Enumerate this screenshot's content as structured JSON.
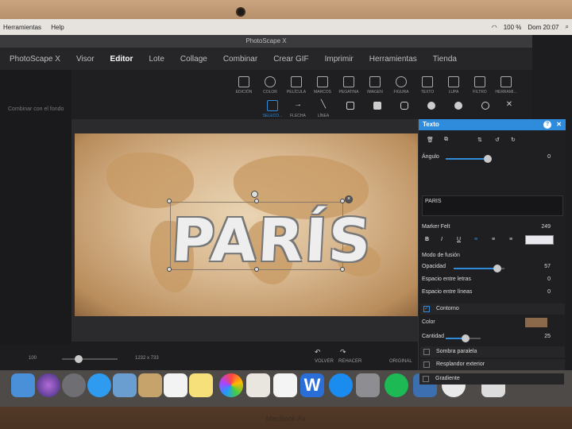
{
  "menubar": {
    "items": [
      "Herramientas",
      "Help"
    ],
    "battery": "100 %",
    "clock": "Dom 20:07"
  },
  "window": {
    "title": "PhotoScape X"
  },
  "tabs": [
    "PhotoScape X",
    "Visor",
    "Editor",
    "Lote",
    "Collage",
    "Combinar",
    "Crear GIF",
    "Imprimir",
    "Herramientas",
    "Tienda"
  ],
  "active_tab": "Editor",
  "toolbar_top": [
    "EDICIÓN",
    "COLOR",
    "PELÍCULA",
    "MARCOS",
    "PEGATINA",
    "IMAGEN",
    "FIGURA",
    "TEXTO",
    "LUPA",
    "FILTRO",
    "HERRAMI..."
  ],
  "toolbar_bottom": [
    "SELECO...",
    "FLECHA",
    "LÍNEA"
  ],
  "leftpanel": {
    "hint": "Combinar con el fondo"
  },
  "canvas": {
    "text": "PARÍS"
  },
  "status": {
    "zoom": "100",
    "dimensions": "1232 x 733",
    "back": "VOLVER",
    "redo": "REHACER",
    "original": "ORIGINAL"
  },
  "panel": {
    "title": "Texto",
    "angle_label": "Ángulo",
    "angle_value": "0",
    "text_value": "PARIS",
    "font_name": "Marker Felt",
    "font_size": "249",
    "blend_label": "Modo de fusión",
    "opacity_label": "Opacidad",
    "opacity_value": "57",
    "letter_spacing_label": "Espacio entre letras",
    "letter_spacing_value": "0",
    "line_spacing_label": "Espacio entre líneas",
    "line_spacing_value": "0",
    "outline_label": "Contorno",
    "color_label": "Color",
    "amount_label": "Cantidad",
    "amount_value": "25",
    "shadow_label": "Sombra paralela",
    "glow_label": "Resplandor exterior",
    "gradient_label": "Gradiente"
  },
  "brand": "MacBook Air",
  "colors": {
    "accent": "#2f8bdc",
    "outline_color": "#8a6a4a"
  }
}
